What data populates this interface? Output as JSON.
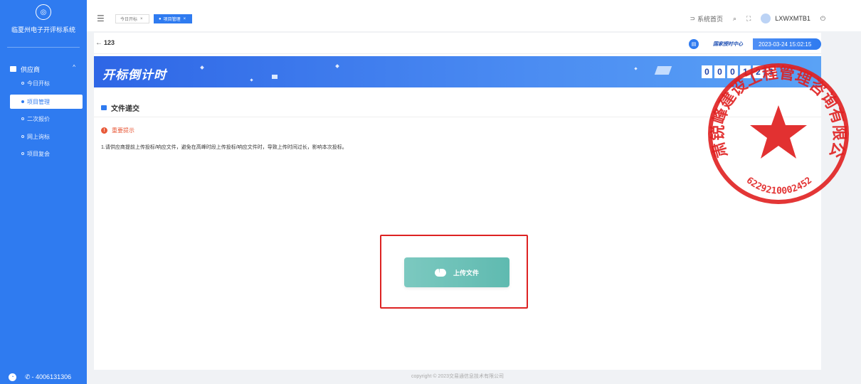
{
  "sidebar": {
    "system_title": "临夏州电子开评标系统",
    "group_label": "供应商",
    "items": [
      {
        "label": "今日开标",
        "active": false
      },
      {
        "label": "项目管理",
        "active": true
      },
      {
        "label": "二次报价",
        "active": false
      },
      {
        "label": "网上询标",
        "active": false
      },
      {
        "label": "项目复会",
        "active": false
      }
    ],
    "phone": "- 4006131306"
  },
  "topbar": {
    "tabs": [
      {
        "label": "今日开标",
        "active": false
      },
      {
        "label": "项目管理",
        "active": true
      }
    ],
    "home_link": "系统首页",
    "username": "LXWXMTB1"
  },
  "content": {
    "back_title": "123",
    "brand": "国家授时中心",
    "datetime": "2023-03-24 15:02:15",
    "banner_title": "开标倒计时",
    "countdown_digits": [
      "0",
      "0",
      "0",
      "1",
      "2",
      "3"
    ],
    "section_title": "文件递交",
    "notice_title": "重要提示",
    "notice_text": "1.请供应商提前上传投标/响应文件，避免在高峰时段上传投标/响应文件时，导致上传时间过长，影响本次投标。",
    "upload_label": "上传文件"
  },
  "footer": {
    "copyright": "copyright © 2023交易通信息技术有限公司"
  },
  "stamp": {
    "ring_text": "甘肃锐峰建设工程管理咨询有限公司",
    "number": "6229210002452"
  },
  "colors": {
    "primary": "#2f7bf0",
    "upload": "#5fbab0",
    "highlight": "#dd2222",
    "stamp": "#e02020"
  }
}
